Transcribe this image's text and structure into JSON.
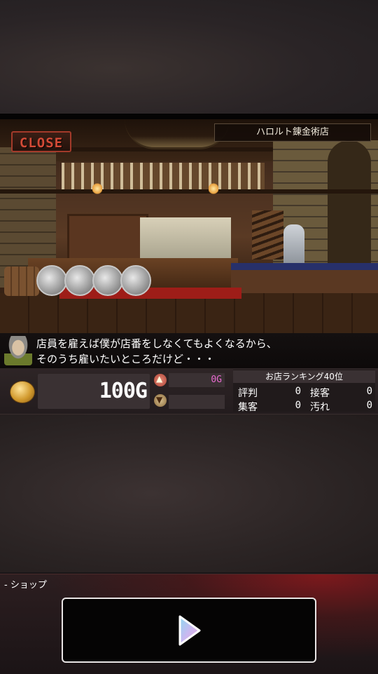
{
  "scene": {
    "close_label": "CLOSE",
    "shop_name": "ハロルト錬金術店"
  },
  "dialogue": {
    "line1": "店員を雇えば僕が店番をしなくてもよくなるから、",
    "line2": "そのうち雇いたいところだけど・・・"
  },
  "status": {
    "money": "100G",
    "gain": "0G",
    "loss": "",
    "ranking_title": "お店ランキング40位",
    "stats": [
      {
        "label": "評判",
        "value": "0"
      },
      {
        "label": "接客",
        "value": "0"
      },
      {
        "label": "集客",
        "value": "0"
      },
      {
        "label": "汚れ",
        "value": "0"
      }
    ]
  },
  "shop": {
    "label": "- ショップ"
  },
  "icons": {
    "coin": "gold-coin-icon",
    "up": "income-up-icon",
    "down": "expense-down-icon",
    "play": "play-triangle-icon"
  },
  "colors": {
    "gain_text": "#e86ad0",
    "close_text": "#d24a36",
    "rug": "#9e1d18",
    "shop_glow": "#8c181c"
  }
}
